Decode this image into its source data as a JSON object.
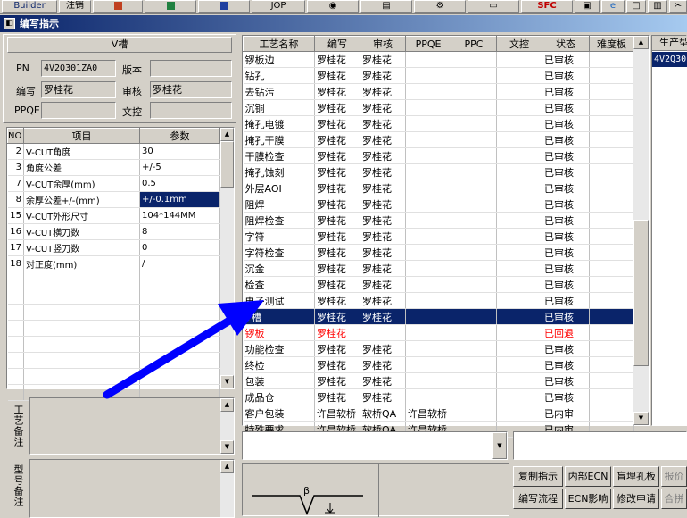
{
  "toolbar": {
    "builder": "Builder",
    "cancel": "注销",
    "jop": "JOP",
    "sfc": "SFC"
  },
  "window": {
    "title": "编写指示"
  },
  "process_panel": {
    "name": "V槽",
    "pn_label": "PN",
    "pn_value": "4V2Q301ZA0",
    "version_label": "版本",
    "version_value": "",
    "writer_label": "编写",
    "writer_value": "罗桂花",
    "reviewer_label": "审核",
    "reviewer_value": "罗桂花",
    "ppqe_label": "PPQE",
    "ppqe_value": "",
    "wenkong_label": "文控",
    "wenkong_value": ""
  },
  "param_table": {
    "headers": [
      "NO",
      "项目",
      "参数"
    ],
    "rows": [
      {
        "no": "2",
        "item": "V-CUT角度",
        "value": "30"
      },
      {
        "no": "3",
        "item": "角度公差",
        "value": "+/-5"
      },
      {
        "no": "7",
        "item": "V-CUT余厚(mm)",
        "value": "0.5"
      },
      {
        "no": "8",
        "item": "余厚公差+/-(mm)",
        "value": "+/-0.1mm"
      },
      {
        "no": "15",
        "item": "V-CUT外形尺寸",
        "value": "104*144MM"
      },
      {
        "no": "16",
        "item": "V-CUT横刀数",
        "value": "8"
      },
      {
        "no": "17",
        "item": "V-CUT竖刀数",
        "value": "0"
      },
      {
        "no": "18",
        "item": "对正度(mm)",
        "value": "/"
      }
    ]
  },
  "notes": {
    "craft_label": "工艺备注",
    "model_label": "型号备注"
  },
  "main_table": {
    "headers": [
      "工艺名称",
      "编写",
      "审核",
      "PPQE",
      "PPC",
      "文控",
      "状态",
      "难度板"
    ],
    "rows": [
      {
        "name": "锣板边",
        "writer": "罗桂花",
        "reviewer": "罗桂花",
        "ppqe": "",
        "ppc": "",
        "wk": "",
        "status": "已审核"
      },
      {
        "name": "钻孔",
        "writer": "罗桂花",
        "reviewer": "罗桂花",
        "ppqe": "",
        "ppc": "",
        "wk": "",
        "status": "已审核"
      },
      {
        "name": "去钻污",
        "writer": "罗桂花",
        "reviewer": "罗桂花",
        "ppqe": "",
        "ppc": "",
        "wk": "",
        "status": "已审核"
      },
      {
        "name": "沉铜",
        "writer": "罗桂花",
        "reviewer": "罗桂花",
        "ppqe": "",
        "ppc": "",
        "wk": "",
        "status": "已审核"
      },
      {
        "name": "掩孔电镀",
        "writer": "罗桂花",
        "reviewer": "罗桂花",
        "ppqe": "",
        "ppc": "",
        "wk": "",
        "status": "已审核"
      },
      {
        "name": "掩孔干膜",
        "writer": "罗桂花",
        "reviewer": "罗桂花",
        "ppqe": "",
        "ppc": "",
        "wk": "",
        "status": "已审核"
      },
      {
        "name": "干膜检查",
        "writer": "罗桂花",
        "reviewer": "罗桂花",
        "ppqe": "",
        "ppc": "",
        "wk": "",
        "status": "已审核"
      },
      {
        "name": "掩孔蚀刻",
        "writer": "罗桂花",
        "reviewer": "罗桂花",
        "ppqe": "",
        "ppc": "",
        "wk": "",
        "status": "已审核"
      },
      {
        "name": "外层AOI",
        "writer": "罗桂花",
        "reviewer": "罗桂花",
        "ppqe": "",
        "ppc": "",
        "wk": "",
        "status": "已审核"
      },
      {
        "name": "阻焊",
        "writer": "罗桂花",
        "reviewer": "罗桂花",
        "ppqe": "",
        "ppc": "",
        "wk": "",
        "status": "已审核"
      },
      {
        "name": "阻焊检查",
        "writer": "罗桂花",
        "reviewer": "罗桂花",
        "ppqe": "",
        "ppc": "",
        "wk": "",
        "status": "已审核"
      },
      {
        "name": "字符",
        "writer": "罗桂花",
        "reviewer": "罗桂花",
        "ppqe": "",
        "ppc": "",
        "wk": "",
        "status": "已审核"
      },
      {
        "name": "字符检查",
        "writer": "罗桂花",
        "reviewer": "罗桂花",
        "ppqe": "",
        "ppc": "",
        "wk": "",
        "status": "已审核"
      },
      {
        "name": "沉金",
        "writer": "罗桂花",
        "reviewer": "罗桂花",
        "ppqe": "",
        "ppc": "",
        "wk": "",
        "status": "已审核"
      },
      {
        "name": "检查",
        "writer": "罗桂花",
        "reviewer": "罗桂花",
        "ppqe": "",
        "ppc": "",
        "wk": "",
        "status": "已审核"
      },
      {
        "name": "电子测试",
        "writer": "罗桂花",
        "reviewer": "罗桂花",
        "ppqe": "",
        "ppc": "",
        "wk": "",
        "status": "已审核"
      },
      {
        "name": "V槽",
        "writer": "罗桂花",
        "reviewer": "罗桂花",
        "ppqe": "",
        "ppc": "",
        "wk": "",
        "status": "已审核",
        "selected": true
      },
      {
        "name": "锣板",
        "writer": "罗桂花",
        "reviewer": "",
        "ppqe": "",
        "ppc": "",
        "wk": "",
        "status": "已回退",
        "red": true
      },
      {
        "name": "功能检查",
        "writer": "罗桂花",
        "reviewer": "罗桂花",
        "ppqe": "",
        "ppc": "",
        "wk": "",
        "status": "已审核"
      },
      {
        "name": "终检",
        "writer": "罗桂花",
        "reviewer": "罗桂花",
        "ppqe": "",
        "ppc": "",
        "wk": "",
        "status": "已审核"
      },
      {
        "name": "包装",
        "writer": "罗桂花",
        "reviewer": "罗桂花",
        "ppqe": "",
        "ppc": "",
        "wk": "",
        "status": "已审核"
      },
      {
        "name": "成品仓",
        "writer": "罗桂花",
        "reviewer": "罗桂花",
        "ppqe": "",
        "ppc": "",
        "wk": "",
        "status": "已审核"
      },
      {
        "name": "客户包装",
        "writer": "许昌软桥",
        "reviewer": "软桥QA",
        "ppqe": "许昌软桥",
        "ppc": "",
        "wk": "",
        "status": "已内审"
      },
      {
        "name": "特殊要求",
        "writer": "许昌软桥",
        "reviewer": "软桥QA",
        "ppqe": "许昌软桥",
        "ppc": "",
        "wk": "",
        "status": "已内审"
      }
    ]
  },
  "right_panel": {
    "header": "生产型",
    "value": "4V2Q30"
  },
  "diagram": {
    "angle_symbol": "β"
  },
  "buttons": {
    "copy": "复制指示",
    "internal_ecn": "内部ECN",
    "blind_hole": "盲埋孔板",
    "report": "报价",
    "flow": "编写流程",
    "ecn_effect": "ECN影响",
    "modify_request": "修改申请",
    "merge": "合拼"
  },
  "colors": {
    "selection": "#0a246a",
    "rollback_text": "#ff0000",
    "annotation_arrow": "#0000ff"
  }
}
